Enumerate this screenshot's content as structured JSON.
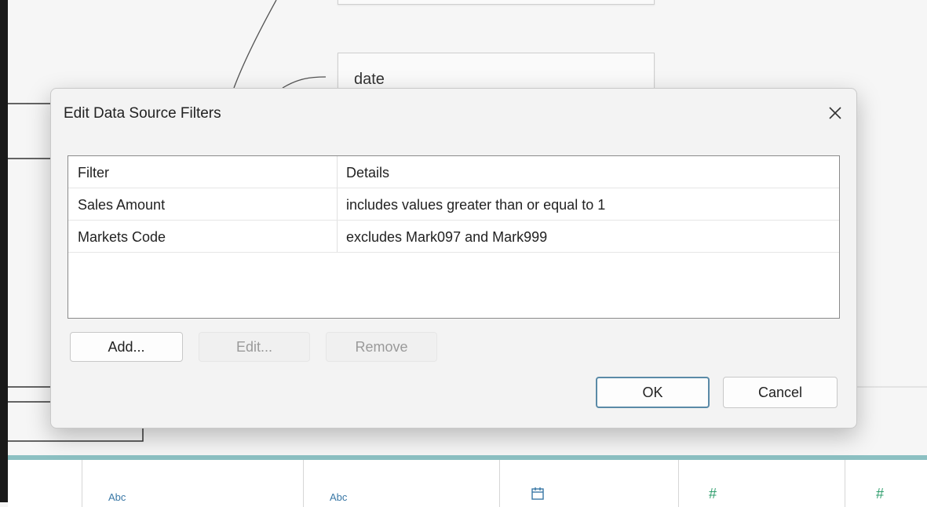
{
  "canvas": {
    "table_date_label": "date"
  },
  "dialog": {
    "title": "Edit Data Source Filters",
    "close_label": "×",
    "columns": {
      "filter": "Filter",
      "details": "Details"
    },
    "filters": [
      {
        "name": "Sales Amount",
        "details": "includes values greater than or equal to 1"
      },
      {
        "name": "Markets Code",
        "details": "excludes Mark097 and Mark999"
      }
    ],
    "buttons": {
      "add": "Add...",
      "edit": "Edit...",
      "remove": "Remove",
      "ok": "OK",
      "cancel": "Cancel"
    }
  },
  "grid": {
    "type_icons": [
      "Abc",
      "Abc",
      "calendar-icon",
      "#",
      "#"
    ]
  }
}
